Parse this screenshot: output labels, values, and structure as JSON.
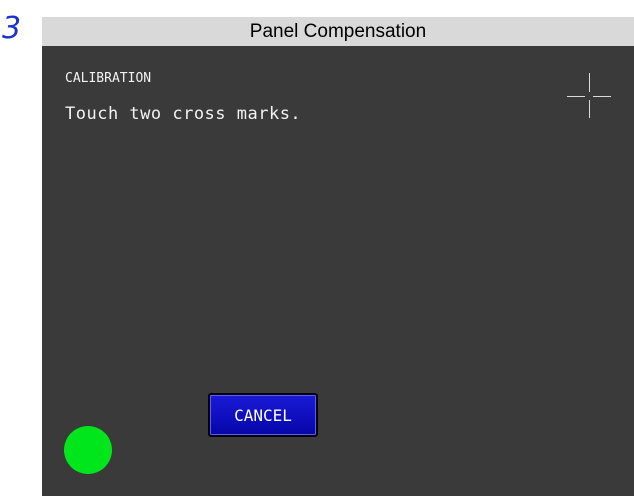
{
  "step": {
    "number": "3"
  },
  "window": {
    "title": "Panel Compensation"
  },
  "screen": {
    "heading": "CALIBRATION",
    "instruction": "Touch two cross marks.",
    "cancel_label": "CANCEL",
    "colors": {
      "background": "#3a3a3a",
      "button": "#1010c0",
      "touch_indicator": "#00e61c"
    },
    "icons": {
      "calibration_target": "crosshair-icon",
      "touch_indicator": "green-circle-icon"
    }
  }
}
